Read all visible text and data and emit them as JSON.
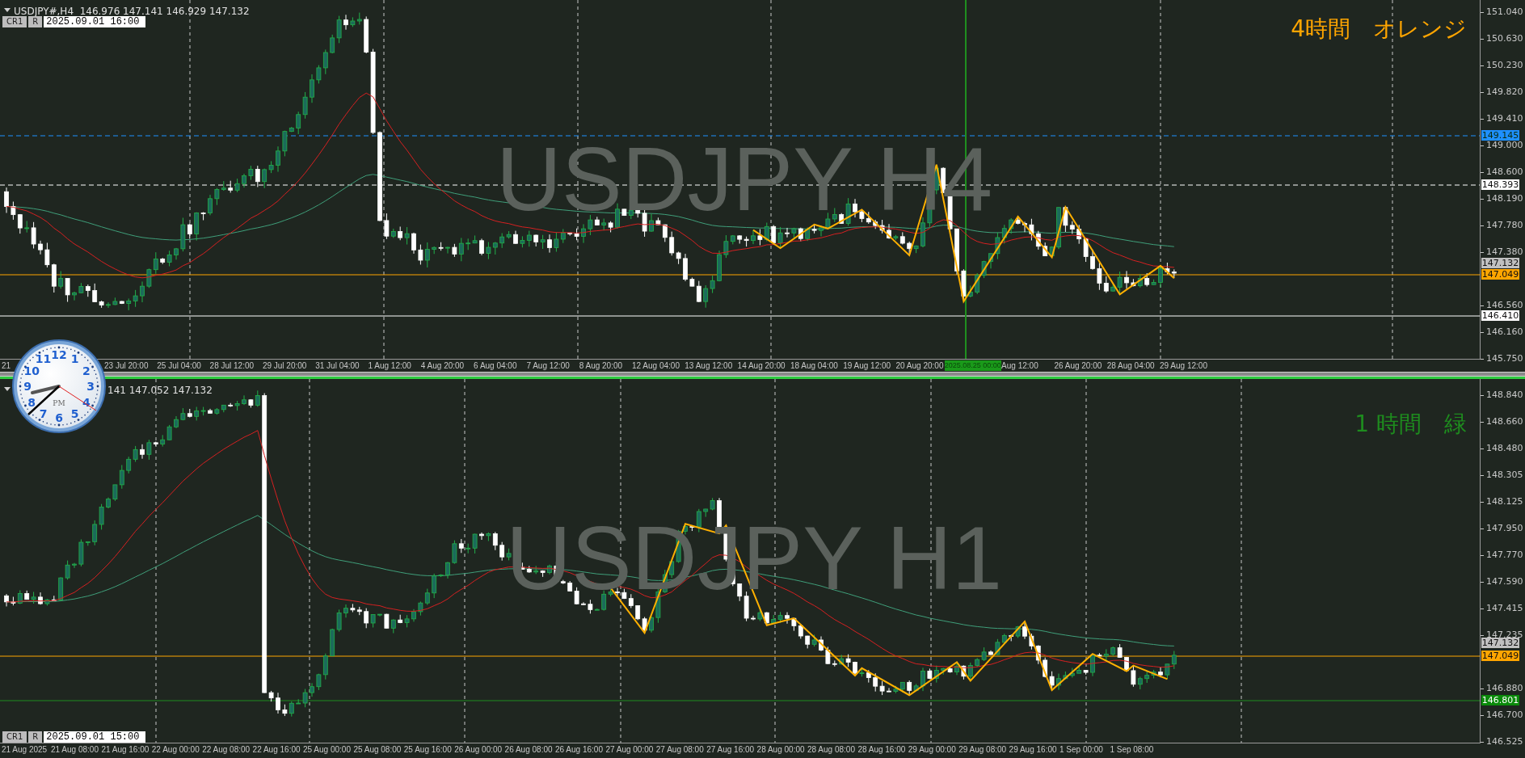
{
  "charts": [
    {
      "symbol_line": "USDJPY#,H4  146.976 147.141 146.929 147.132",
      "buttons": [
        "CR1",
        "R"
      ],
      "datetime": "2025.09.01 16:00",
      "watermark": "USDJPY H4",
      "caption": "4時間　オレンジ",
      "color": "#ffa500",
      "price_labels": [
        "151.040",
        "150.630",
        "150.230",
        "149.820",
        "149.410",
        "149.000",
        "148.600",
        "148.190",
        "147.780",
        "147.380",
        "146.560",
        "146.160",
        "145.750"
      ],
      "price_badges": [
        {
          "text": "149.145",
          "color": "#1e90ff"
        },
        {
          "text": "148.393",
          "color": "#ffffff"
        },
        {
          "text": "147.132",
          "color": "#c0c0c0"
        },
        {
          "text": "147.049",
          "color": "#ffa500"
        },
        {
          "text": "146.410",
          "color": "#ffffff"
        }
      ],
      "time_labels": [
        {
          "text": "21",
          "kind": "label"
        },
        {
          "text": "23 Jul 20:00",
          "kind": "label"
        },
        {
          "text": "25 Jul 04:00",
          "kind": "label"
        },
        {
          "text": "28 Jul 12:00",
          "kind": "label"
        },
        {
          "text": "29 Jul 20:00",
          "kind": "label"
        },
        {
          "text": "31 Jul 04:00",
          "kind": "label"
        },
        {
          "text": "1 Aug 12:00",
          "kind": "label"
        },
        {
          "text": "4 Aug 20:00",
          "kind": "label"
        },
        {
          "text": "6 Aug 04:00",
          "kind": "label"
        },
        {
          "text": "7 Aug 12:00",
          "kind": "label"
        },
        {
          "text": "8 Aug 20:00",
          "kind": "label"
        },
        {
          "text": "12 Aug 04:00",
          "kind": "label"
        },
        {
          "text": "13 Aug 12:00",
          "kind": "label"
        },
        {
          "text": "14 Aug 20:00",
          "kind": "label"
        },
        {
          "text": "18 Aug 04:00",
          "kind": "label"
        },
        {
          "text": "19 Aug 12:00",
          "kind": "label"
        },
        {
          "text": "20 Aug 20:00",
          "kind": "label"
        },
        {
          "text": "2025.08.25 00:00",
          "kind": "cursor"
        },
        {
          "text": "Aug 12:00",
          "kind": "label"
        },
        {
          "text": "26 Aug 20:00",
          "kind": "label"
        },
        {
          "text": "28 Aug 04:00",
          "kind": "label"
        },
        {
          "text": "29 Aug 12:00",
          "kind": "label"
        }
      ]
    },
    {
      "symbol_line": "141 147.052 147.132",
      "buttons": [
        "CR1",
        "R"
      ],
      "datetime": "2025.09.01 15:00",
      "watermark": "USDJPY H1",
      "caption": "1 時間　緑",
      "color": "#1e8c1e",
      "price_labels": [
        "148.840",
        "148.660",
        "148.480",
        "148.305",
        "148.125",
        "147.950",
        "147.770",
        "147.590",
        "147.415",
        "147.235",
        "146.880",
        "146.700",
        "146.525"
      ],
      "price_badges": [
        {
          "text": "147.132",
          "color": "#c0c0c0"
        },
        {
          "text": "147.049",
          "color": "#ffa500"
        },
        {
          "text": "146.801",
          "color": "#0a8a0a"
        }
      ],
      "time_labels": [
        {
          "text": "21 Aug 2025",
          "kind": "label"
        },
        {
          "text": "21 Aug 08:00",
          "kind": "label"
        },
        {
          "text": "21 Aug 16:00",
          "kind": "label"
        },
        {
          "text": "22 Aug 00:00",
          "kind": "label"
        },
        {
          "text": "22 Aug 08:00",
          "kind": "label"
        },
        {
          "text": "22 Aug 16:00",
          "kind": "label"
        },
        {
          "text": "25 Aug 00:00",
          "kind": "label"
        },
        {
          "text": "25 Aug 08:00",
          "kind": "label"
        },
        {
          "text": "25 Aug 16:00",
          "kind": "label"
        },
        {
          "text": "26 Aug 00:00",
          "kind": "label"
        },
        {
          "text": "26 Aug 08:00",
          "kind": "label"
        },
        {
          "text": "26 Aug 16:00",
          "kind": "label"
        },
        {
          "text": "27 Aug 00:00",
          "kind": "label"
        },
        {
          "text": "27 Aug 08:00",
          "kind": "label"
        },
        {
          "text": "27 Aug 16:00",
          "kind": "label"
        },
        {
          "text": "28 Aug 00:00",
          "kind": "label"
        },
        {
          "text": "28 Aug 08:00",
          "kind": "label"
        },
        {
          "text": "28 Aug 16:00",
          "kind": "label"
        },
        {
          "text": "29 Aug 00:00",
          "kind": "label"
        },
        {
          "text": "29 Aug 08:00",
          "kind": "label"
        },
        {
          "text": "29 Aug 16:00",
          "kind": "label"
        },
        {
          "text": "1 Sep 00:00",
          "kind": "label"
        },
        {
          "text": "1 Sep 08:00",
          "kind": "label"
        }
      ]
    }
  ],
  "clock": {
    "numerals": [
      "12",
      "11",
      "1",
      "10",
      "2",
      "9",
      "3",
      "8",
      "4",
      "7",
      "5",
      "6"
    ],
    "meridiem": "PM"
  }
}
